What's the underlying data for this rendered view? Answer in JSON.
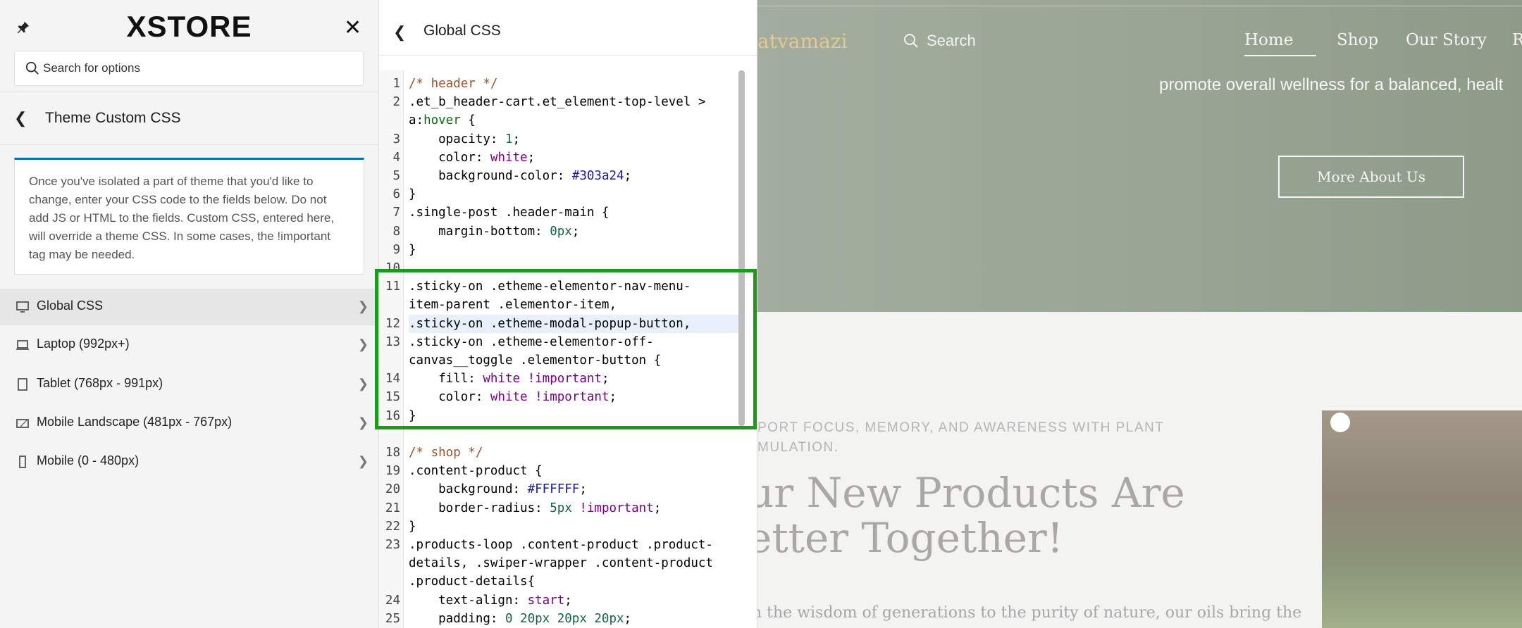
{
  "sidebar": {
    "logo": "XSTORE",
    "search_placeholder": "Search for options",
    "section_title": "Theme Custom CSS",
    "notice": "Once you've isolated a part of theme that you'd like to change, enter your CSS code to the fields below. Do not add JS or HTML to the fields. Custom CSS, entered here, will override a theme CSS. In some cases, the !important tag may be needed.",
    "items": [
      {
        "label": "Global CSS",
        "icon": "desktop-icon"
      },
      {
        "label": "Laptop (992px+)",
        "icon": "laptop-icon"
      },
      {
        "label": "Tablet (768px - 991px)",
        "icon": "tablet-icon"
      },
      {
        "label": "Mobile Landscape (481px - 767px)",
        "icon": "mobile-landscape-icon"
      },
      {
        "label": "Mobile (0 - 480px)",
        "icon": "mobile-icon"
      }
    ]
  },
  "css_panel": {
    "title": "Global CSS",
    "line_numbers": "1\n2\n\n3\n4\n5\n6\n7\n8\n9\n10\n11\n\n12\n13\n\n14\n15\n16\n\n18\n19\n20\n21\n22\n23\n\n\n24\n25"
  },
  "preview": {
    "logo": "atvamazi",
    "search": "Search",
    "nav": [
      "Home",
      "Shop",
      "Our Story",
      "Researc"
    ],
    "hero_text": "promote overall wellness for a balanced, healt",
    "hero_button": "More About Us",
    "kicker": "PORT FOCUS, MEMORY, AND AWARENESS WITH PLANT\nMULATION.",
    "heading": "ur New Products Are\netter Together!",
    "body": "n the wisdom of generations to the purity of nature, our oils bring the"
  },
  "colors": {
    "accent": "#0073aa",
    "highlight_box": "#1b9a1b"
  }
}
